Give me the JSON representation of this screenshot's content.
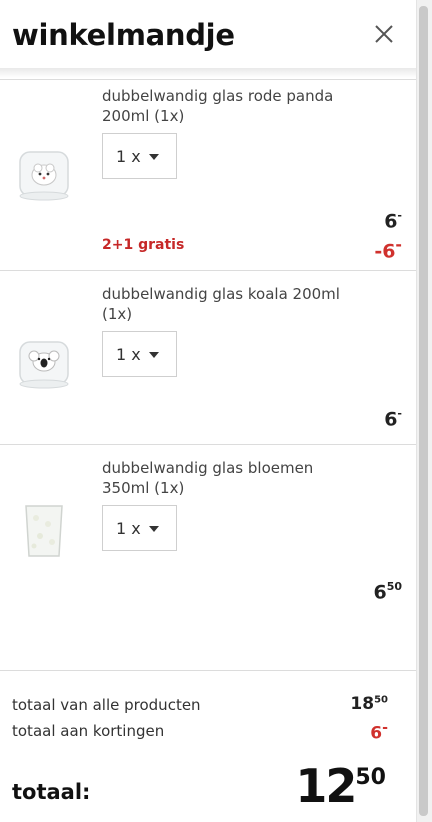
{
  "header": {
    "title": "winkelmandje",
    "close_icon": "close-icon"
  },
  "items": [
    {
      "name": "dubbelwandig glas rode panda 200ml (1x)",
      "quantity": "1 x",
      "price_main": "6",
      "price_sup": "-",
      "promo": "2+1 gratis",
      "discount": "-6",
      "discount_sup": "-",
      "icon": "glass-red-panda-image"
    },
    {
      "name": "dubbelwandig glas koala 200ml (1x)",
      "quantity": "1 x",
      "price_main": "6",
      "price_sup": "-",
      "icon": "glass-koala-image"
    },
    {
      "name": "dubbelwandig glas bloemen 350ml (1x)",
      "quantity": "1 x",
      "price_main": "6",
      "price_sup": "50",
      "icon": "glass-flowers-image"
    }
  ],
  "summary": {
    "products_label": "totaal van alle producten",
    "products_main": "18",
    "products_sup": "50",
    "discounts_label": "totaal aan kortingen",
    "discounts_main": "6",
    "discounts_sup": "-",
    "total_label": "totaal:",
    "total_main": "12",
    "total_sup": "50"
  },
  "colors": {
    "discount_red": "#d0312d",
    "text_dark": "#111111"
  }
}
